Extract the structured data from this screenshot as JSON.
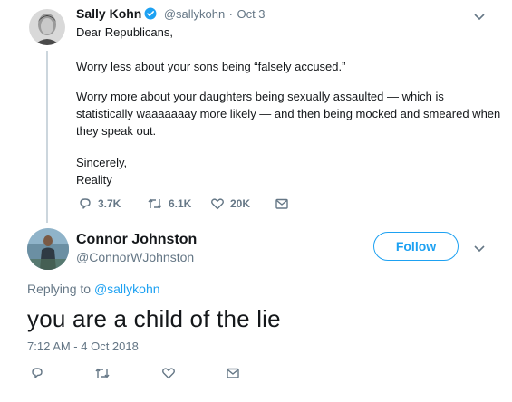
{
  "parent_tweet": {
    "author_name": "Sally Kohn",
    "handle": "@sallykohn",
    "separator": "·",
    "date": "Oct 3",
    "lines": [
      "Dear Republicans,",
      "Worry less about your sons being “falsely accused.”",
      "Worry more about your daughters being sexually assaulted — which is",
      "statistically waaaaaaay more likely — and then being mocked and smeared when",
      "they speak out.",
      "Sincerely,",
      "Reality"
    ],
    "actions": {
      "reply_count": "3.7K",
      "retweet_count": "6.1K",
      "like_count": "20K"
    },
    "icons": [
      "verified-badge-icon",
      "reply-icon",
      "retweet-icon",
      "like-icon",
      "message-icon",
      "chevron-down-icon"
    ]
  },
  "reply_tweet": {
    "author_name": "Connor Johnston",
    "handle": "@ConnorWJohnston",
    "follow_label": "Follow",
    "replying_prefix": "Replying to",
    "replying_to": "@sallykohn",
    "text": "you are a child of the lie",
    "timestamp": "7:12 AM - 4 Oct 2018"
  },
  "colors": {
    "accent": "#1da1f2",
    "secondary_text": "#657786",
    "primary_text": "#14171a",
    "thread_line": "#ccd6dd"
  }
}
